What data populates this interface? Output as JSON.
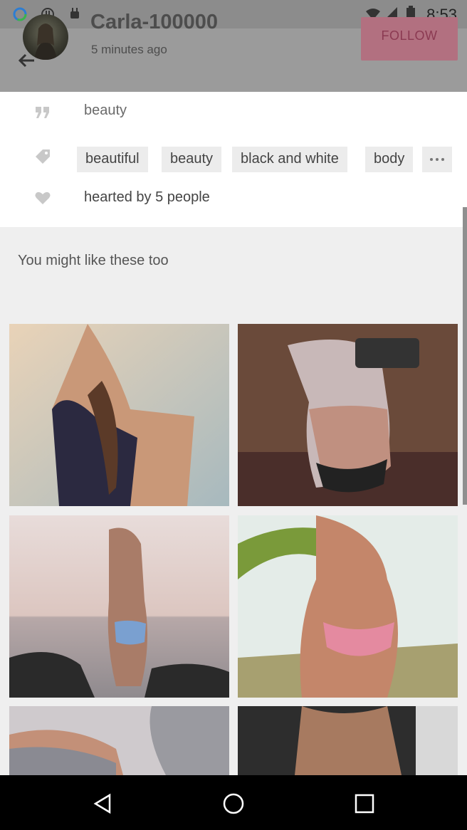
{
  "status_bar": {
    "time": "8:53"
  },
  "header": {
    "user_name": "Carla-100000",
    "post_time": "5 minutes ago",
    "follow_label": "FOLLOW"
  },
  "post": {
    "caption": "beauty",
    "tags": [
      "beautiful",
      "beauty",
      "black and white",
      "body"
    ],
    "hearted_text": "hearted by 5 people"
  },
  "suggestions": {
    "title": "You might like these too"
  },
  "icons": {
    "back": "arrow-left-icon",
    "caption": "quote-icon",
    "tags": "tag-icon",
    "hearts": "heart-icon",
    "more": "more-horizontal-icon"
  },
  "colors": {
    "follow_bg": "#b27080",
    "header_bg": "#9b9b9b",
    "suggest_bg": "#efefef"
  }
}
